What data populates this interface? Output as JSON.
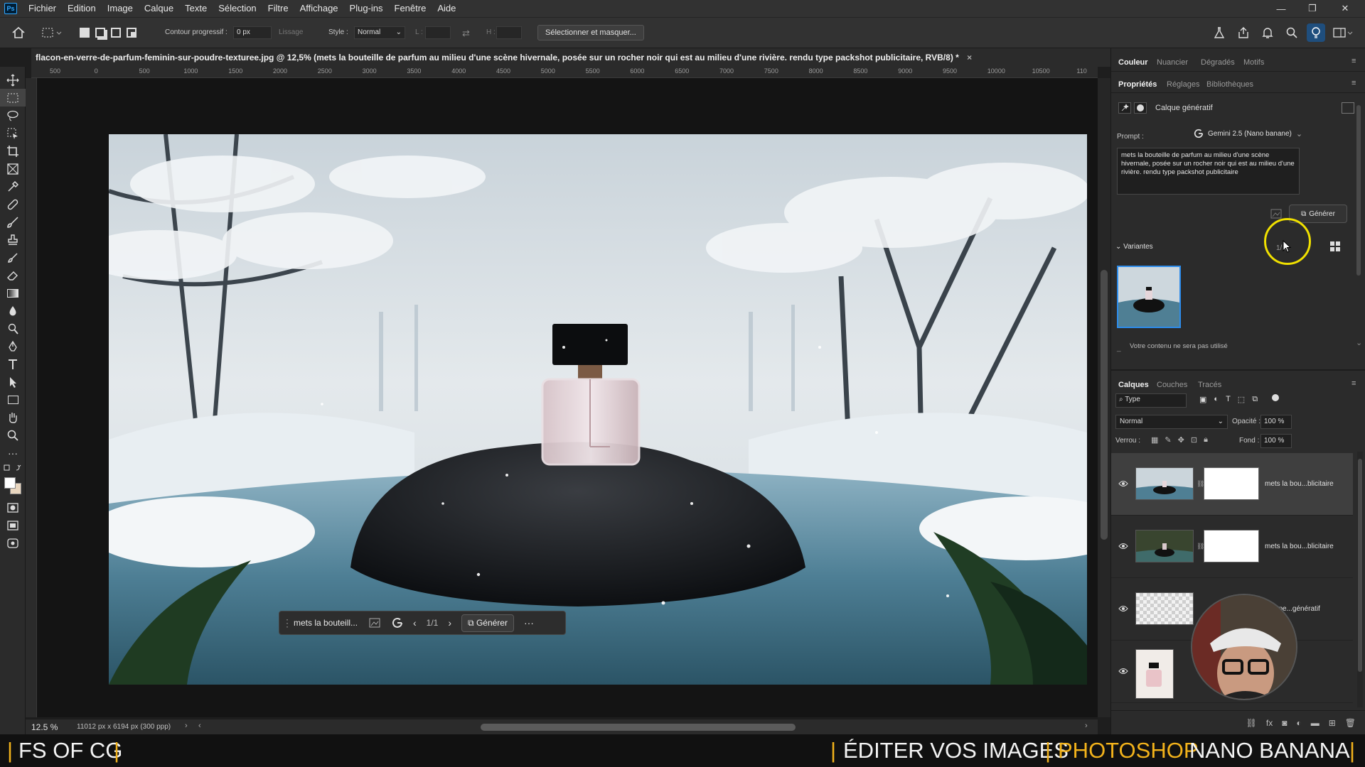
{
  "menubar": {
    "logo": "Ps",
    "items": [
      "Fichier",
      "Edition",
      "Image",
      "Calque",
      "Texte",
      "Sélection",
      "Filtre",
      "Affichage",
      "Plug-ins",
      "Fenêtre",
      "Aide"
    ]
  },
  "options": {
    "feather_label": "Contour progressif :",
    "feather_value": "0 px",
    "antialias_label": "Lissage",
    "style_label": "Style :",
    "style_value": "Normal",
    "width_label": "L :",
    "height_label": "H :",
    "select_mask_button": "Sélectionner et masquer..."
  },
  "document": {
    "title": "flacon-en-verre-de-parfum-feminin-sur-poudre-texturee.jpg @ 12,5% (mets la bouteille de parfum au milieu d'une scène hivernale, posée sur un rocher noir qui est au milieu d'une rivière. rendu type packshot publicitaire, RVB/8) *",
    "close": "×"
  },
  "ruler": {
    "ticks": [
      "500",
      "0",
      "500",
      "1000",
      "1500",
      "2000",
      "2500",
      "3000",
      "3500",
      "4000",
      "4500",
      "5000",
      "5500",
      "6000",
      "6500",
      "7000",
      "7500",
      "8000",
      "8500",
      "9000",
      "9500",
      "10000",
      "10500",
      "110"
    ]
  },
  "contextbar": {
    "prompt_short": "mets la bouteill...",
    "page": "1/1",
    "generate": "Générer",
    "more": "···"
  },
  "status": {
    "zoom": "12.5 %",
    "dims": "11012 px x 6194 px (300 ppp)"
  },
  "panel": {
    "top_tabs": [
      "Couleur",
      "Nuancier",
      "Dégradés",
      "Motifs"
    ],
    "prop_tabs": [
      "Propriétés",
      "Réglages",
      "Bibliothèques"
    ],
    "layer_type": "Calque génératif",
    "prompt_label": "Prompt :",
    "model": "Gemini 2.5 (Nano banane)",
    "prompt_text": "mets la bouteille de parfum au milieu d'une scène hivernale, posée sur un rocher noir qui est au milieu d'une rivière. rendu type packshot publicitaire",
    "generate_button": "Générer",
    "variants_label": "Variantes",
    "variants_count": "1/1",
    "notice": "Votre contenu ne sera pas utilisé"
  },
  "layers_panel": {
    "tabs": [
      "Calques",
      "Couches",
      "Tracés"
    ],
    "filter": "Type",
    "blend": "Normal",
    "opacity_label": "Opacité :",
    "opacity_value": "100 %",
    "lock_label": "Verrou :",
    "fill_label": "Fond :",
    "fill_value": "100 %",
    "layers": [
      {
        "name": "mets la bou...blicitaire"
      },
      {
        "name": "mets la bou...blicitaire"
      },
      {
        "name": "...oppe...génératif"
      },
      {
        "name": ""
      }
    ]
  },
  "banner": {
    "left": "FS OF CG",
    "right_a": "ÉDITER VOS IMAGES",
    "right_b": "PHOTOSHOP",
    "right_c": "NANO BANANA"
  },
  "colors": {
    "accent_blue": "#2d8ceb",
    "banner_yellow": "#f2b21b",
    "cursor_ring": "#f0e000"
  }
}
